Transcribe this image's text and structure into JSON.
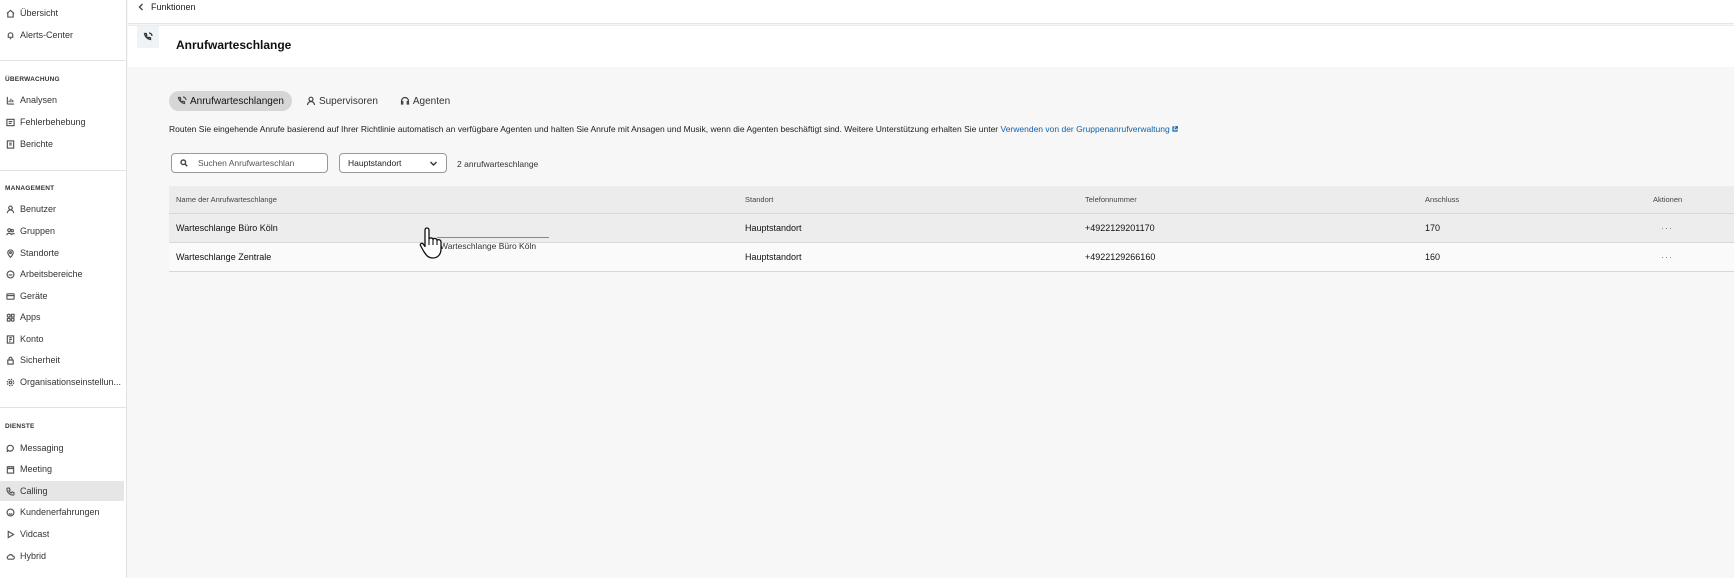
{
  "sidebar": {
    "top_items": [
      {
        "label": "Übersicht",
        "icon": "home-icon"
      },
      {
        "label": "Alerts-Center",
        "icon": "bell-icon"
      }
    ],
    "sections": [
      {
        "title": "ÜBERWACHUNG",
        "items": [
          {
            "label": "Analysen",
            "icon": "chart-icon"
          },
          {
            "label": "Fehlerbehebung",
            "icon": "troubleshoot-icon"
          },
          {
            "label": "Berichte",
            "icon": "report-icon"
          }
        ]
      },
      {
        "title": "MANAGEMENT",
        "items": [
          {
            "label": "Benutzer",
            "icon": "user-icon"
          },
          {
            "label": "Gruppen",
            "icon": "group-icon"
          },
          {
            "label": "Standorte",
            "icon": "location-icon"
          },
          {
            "label": "Arbeitsbereiche",
            "icon": "workspace-icon"
          },
          {
            "label": "Geräte",
            "icon": "device-icon"
          },
          {
            "label": "Apps",
            "icon": "apps-icon"
          },
          {
            "label": "Konto",
            "icon": "account-icon"
          },
          {
            "label": "Sicherheit",
            "icon": "security-icon"
          },
          {
            "label": "Organisationseinstellun...",
            "icon": "settings-icon"
          }
        ]
      },
      {
        "title": "DIENSTE",
        "items": [
          {
            "label": "Messaging",
            "icon": "message-icon"
          },
          {
            "label": "Meeting",
            "icon": "calendar-icon"
          },
          {
            "label": "Calling",
            "icon": "phone-icon",
            "active": true
          },
          {
            "label": "Kundenerfahrungen",
            "icon": "customer-icon"
          },
          {
            "label": "Vidcast",
            "icon": "play-icon"
          },
          {
            "label": "Hybrid",
            "icon": "cloud-icon"
          }
        ]
      }
    ]
  },
  "breadcrumb": {
    "label": "Funktionen",
    "icon": "chevron-left-icon"
  },
  "header": {
    "title": "Anrufwarteschlange",
    "icon": "call-queue-icon"
  },
  "tabs": [
    {
      "label": "Anrufwarteschlangen",
      "icon": "call-queue-icon",
      "active": true
    },
    {
      "label": "Supervisoren",
      "icon": "supervisor-icon"
    },
    {
      "label": "Agenten",
      "icon": "headset-icon"
    }
  ],
  "description": {
    "text": "Routen Sie eingehende Anrufe basierend auf Ihrer Richtlinie automatisch an verfügbare Agenten und halten Sie Anrufe mit Ansagen und Musik, wenn die Agenten beschäftigt sind. Weitere Unterstützung erhalten Sie unter ",
    "link": "Verwenden von der Gruppenanrufverwaltung"
  },
  "filters": {
    "search_placeholder": "Suchen Anrufwarteschlan",
    "location_value": "Hauptstandort",
    "count": "2 anrufwarteschlange"
  },
  "table": {
    "headers": [
      "Name der Anrufwarteschlange",
      "Standort",
      "Telefonnummer",
      "Anschluss",
      "Aktionen"
    ],
    "rows": [
      {
        "name": "Warteschlange Büro Köln",
        "location": "Hauptstandort",
        "phone": "+4922129201170",
        "extension": "170",
        "actions": "···"
      },
      {
        "name": "Warteschlange Zentrale",
        "location": "Hauptstandort",
        "phone": "+4922129266160",
        "extension": "160",
        "actions": "···"
      }
    ]
  },
  "tooltip": "Warteschlange Büro Köln"
}
